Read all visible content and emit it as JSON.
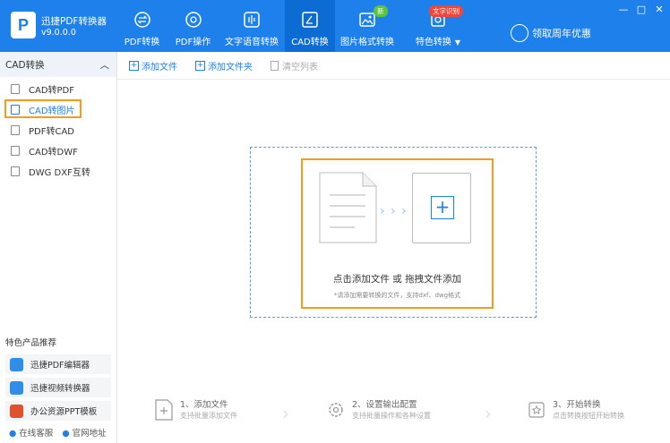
{
  "app": {
    "logo_letter": "P",
    "name": "迅捷PDF转换器",
    "version": "v9.0.0.0"
  },
  "nav": [
    {
      "label": "PDF转换",
      "icon": "pdf-convert-icon",
      "active": false
    },
    {
      "label": "PDF操作",
      "icon": "pdf-ops-icon",
      "active": false
    },
    {
      "label": "文字语音转换",
      "icon": "audio-icon",
      "active": false
    },
    {
      "label": "CAD转换",
      "icon": "cad-icon",
      "active": true
    },
    {
      "label": "图片格式转换",
      "icon": "image-icon",
      "active": false,
      "badge": "新"
    },
    {
      "label": "特色转换",
      "icon": "special-icon",
      "active": false,
      "badge": "文字识别",
      "caret": "▼"
    }
  ],
  "promo": {
    "label": "领取周年优惠"
  },
  "window": {
    "minimize": "—",
    "restore": "□",
    "close": "✕"
  },
  "sidebar": {
    "section_title": "CAD转换",
    "collapse": "︿",
    "items": [
      {
        "label": "CAD转PDF"
      },
      {
        "label": "CAD转图片"
      },
      {
        "label": "PDF转CAD"
      },
      {
        "label": "CAD转DWF"
      },
      {
        "label": "DWG DXF互转"
      }
    ],
    "featured_title": "特色产品推荐",
    "featured": [
      {
        "label": "迅捷PDF编辑器",
        "color": "#2f8ee8"
      },
      {
        "label": "迅捷视频转换器",
        "color": "#2f8ee8"
      },
      {
        "label": "办公资源PPT模板",
        "color": "#e0522e"
      }
    ],
    "footer": {
      "service": "在线客服",
      "website": "官网地址"
    }
  },
  "toolbar": {
    "add_file": "添加文件",
    "add_folder": "添加文件夹",
    "clear_list": "清空列表"
  },
  "dropzone": {
    "arrows": "› › ›",
    "plus": "+",
    "main_text": "点击添加文件 或 拖拽文件添加",
    "sub_text": "*请添加需要转换的文件，支持dxf、dwg格式"
  },
  "steps": [
    {
      "title": "1、添加文件",
      "desc": "支持批量添加文件"
    },
    {
      "title": "2、设置输出配置",
      "desc": "支持批量操作和各种设置"
    },
    {
      "title": "3、开始转换",
      "desc": "点击转换按钮开始转换"
    }
  ],
  "colors": {
    "brand": "#1e80ea",
    "highlight": "#f19c1a",
    "nav_active": "#0d6cd4"
  }
}
